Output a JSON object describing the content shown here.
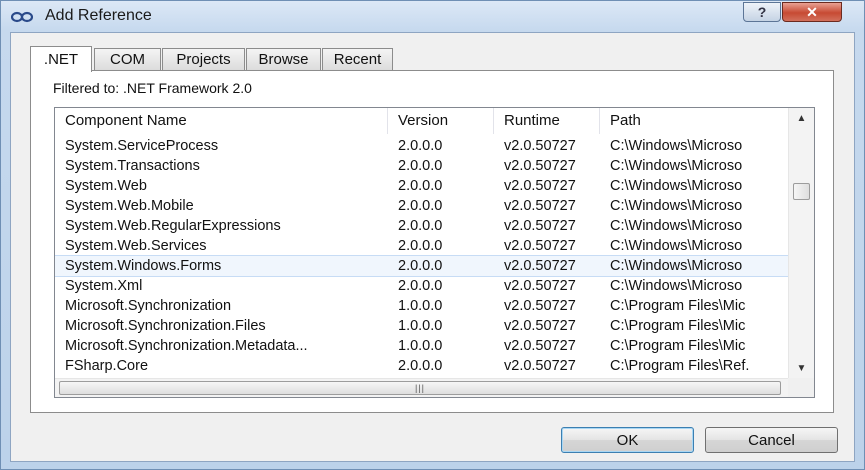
{
  "window": {
    "title": "Add Reference",
    "help_label": "?",
    "close_label": "✕"
  },
  "tabs": [
    {
      "label": ".NET",
      "active": true
    },
    {
      "label": "COM",
      "active": false
    },
    {
      "label": "Projects",
      "active": false
    },
    {
      "label": "Browse",
      "active": false
    },
    {
      "label": "Recent",
      "active": false
    }
  ],
  "filter_text": "Filtered to: .NET Framework 2.0",
  "list": {
    "columns": [
      "Component Name",
      "Version",
      "Runtime",
      "Path"
    ],
    "rows": [
      {
        "name": "System.ServiceProcess",
        "version": "2.0.0.0",
        "runtime": "v2.0.50727",
        "path": "C:\\Windows\\Microso"
      },
      {
        "name": "System.Transactions",
        "version": "2.0.0.0",
        "runtime": "v2.0.50727",
        "path": "C:\\Windows\\Microso"
      },
      {
        "name": "System.Web",
        "version": "2.0.0.0",
        "runtime": "v2.0.50727",
        "path": "C:\\Windows\\Microso"
      },
      {
        "name": "System.Web.Mobile",
        "version": "2.0.0.0",
        "runtime": "v2.0.50727",
        "path": "C:\\Windows\\Microso"
      },
      {
        "name": "System.Web.RegularExpressions",
        "version": "2.0.0.0",
        "runtime": "v2.0.50727",
        "path": "C:\\Windows\\Microso"
      },
      {
        "name": "System.Web.Services",
        "version": "2.0.0.0",
        "runtime": "v2.0.50727",
        "path": "C:\\Windows\\Microso"
      },
      {
        "name": "System.Windows.Forms",
        "version": "2.0.0.0",
        "runtime": "v2.0.50727",
        "path": "C:\\Windows\\Microso",
        "selected": true
      },
      {
        "name": "System.Xml",
        "version": "2.0.0.0",
        "runtime": "v2.0.50727",
        "path": "C:\\Windows\\Microso"
      },
      {
        "name": "Microsoft.Synchronization",
        "version": "1.0.0.0",
        "runtime": "v2.0.50727",
        "path": "C:\\Program Files\\Mic"
      },
      {
        "name": "Microsoft.Synchronization.Files",
        "version": "1.0.0.0",
        "runtime": "v2.0.50727",
        "path": "C:\\Program Files\\Mic"
      },
      {
        "name": "Microsoft.Synchronization.Metadata...",
        "version": "1.0.0.0",
        "runtime": "v2.0.50727",
        "path": "C:\\Program Files\\Mic"
      },
      {
        "name": "FSharp.Core",
        "version": "2.0.0.0",
        "runtime": "v2.0.50727",
        "path": "C:\\Program Files\\Ref."
      }
    ]
  },
  "buttons": {
    "ok": "OK",
    "cancel": "Cancel"
  },
  "colors": {
    "selected_row": "#f0f6fd",
    "close_button": "#c74a33",
    "title_bar": "#c6d9ee"
  },
  "icons": {
    "app": "link-chain-icon",
    "scroll_up": "arrow-up-icon",
    "scroll_down": "arrow-down-icon",
    "grip": "grip-icon"
  }
}
